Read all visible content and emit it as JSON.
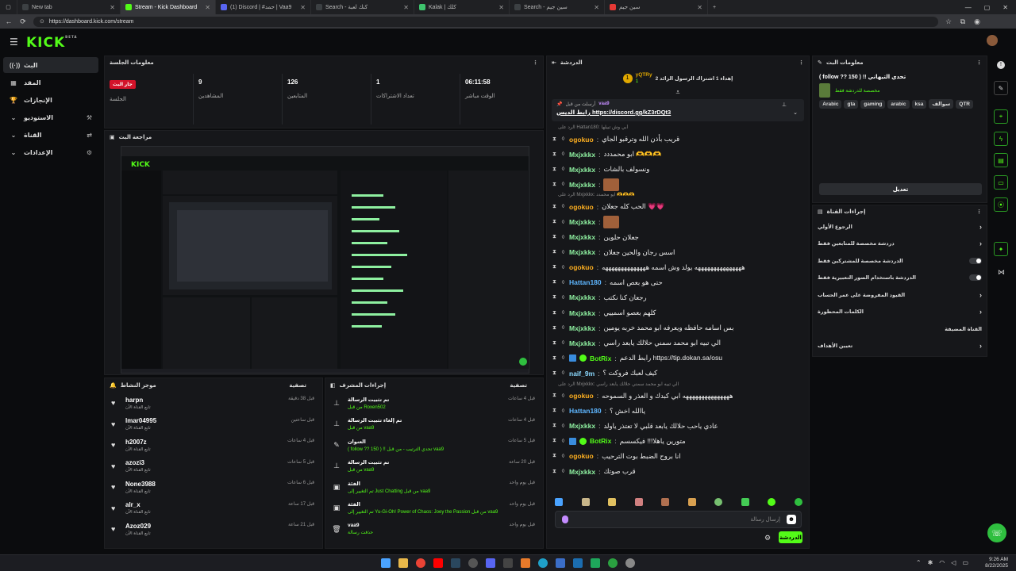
{
  "browser": {
    "tabs": [
      {
        "label": "New tab",
        "color": "#3c4043",
        "active": false
      },
      {
        "label": "Stream - Kick Dashboard",
        "color": "#53fc18",
        "active": true
      },
      {
        "label": "(1) Discord | #حمد | Vaa9",
        "color": "#5865f2",
        "active": false
      },
      {
        "label": "Search - كنك لعبة",
        "color": "#3c4043",
        "active": false
      },
      {
        "label": "Kalak | كلك",
        "color": "#3ec46d",
        "active": false
      },
      {
        "label": "Search - سين جيم",
        "color": "#3c4043",
        "active": false
      },
      {
        "label": "سين جيم",
        "color": "#e53935",
        "active": false
      }
    ],
    "url": "https://dashboard.kick.com/stream"
  },
  "header": {
    "logo": "KICK",
    "logo_sup": "BETA"
  },
  "sidebar": {
    "items": [
      {
        "label": "البث",
        "icon": "broadcast-icon",
        "glyph": "((·))",
        "active": true
      },
      {
        "label": "المقد",
        "icon": "calendar-icon",
        "glyph": "▦",
        "active": false
      },
      {
        "label": "الإنجازات",
        "icon": "trophy-icon",
        "glyph": "🏆",
        "active": false
      },
      {
        "label": "الاستوديو",
        "icon": "studio-icon",
        "glyph": "⌄",
        "right": "⚒",
        "active": false
      },
      {
        "label": "القناة",
        "icon": "channel-icon",
        "glyph": "⌄",
        "right": "⇄",
        "active": false
      },
      {
        "label": "الإعدادات",
        "icon": "settings-icon",
        "glyph": "⌄",
        "right": "⚙",
        "active": false
      }
    ]
  },
  "session": {
    "title": "معلومات الجلسة",
    "live_badge": "جار البث",
    "stats": [
      {
        "value": "",
        "label": "الجلسة"
      },
      {
        "value": "9",
        "label": "المشاهدين"
      },
      {
        "value": "126",
        "label": "المتابعين"
      },
      {
        "value": "1",
        "label": "تعداد الاشتراكات"
      },
      {
        "value": "06:11:58",
        "label": "الوقت مباشر"
      }
    ]
  },
  "preview": {
    "title": "مراجعة البث"
  },
  "activity": {
    "title": "موجز النشاط",
    "filter": "تصفية",
    "items": [
      {
        "name": "harpn",
        "sub": "تابع القناة الآن",
        "time": "قبل 38 دقيقة"
      },
      {
        "name": "lmar04995",
        "sub": "تابع القناة الآن",
        "time": "قبل ساعتين"
      },
      {
        "name": "h2007z",
        "sub": "تابع القناة الآن",
        "time": "قبل 4 ساعات"
      },
      {
        "name": "azozi3",
        "sub": "تابع القناة الآن",
        "time": "قبل 5 ساعات"
      },
      {
        "name": "None3988",
        "sub": "تابع القناة الآن",
        "time": "قبل 6 ساعات"
      },
      {
        "name": "alr_x",
        "sub": "تابع القناة الآن",
        "time": "قبل 17 ساعة"
      },
      {
        "name": "Azoz029",
        "sub": "تابع القناة الآن",
        "time": "قبل 21 ساعة"
      }
    ]
  },
  "mod_actions": {
    "title": "إجراءات المشرف",
    "filter": "تصفية",
    "items": [
      {
        "icon": "pin-icon",
        "glyph": "⊥",
        "t1": "تم تثبيت الرسالة",
        "t2": "من قبل Roxen502",
        "time": "قبل 4 ساعات"
      },
      {
        "icon": "pin-icon",
        "glyph": "⊥",
        "t1": "تم إلغاء تثبيت الرسالة",
        "t2": "من قبل vaa9",
        "time": "قبل 4 ساعات"
      },
      {
        "icon": "title-icon",
        "glyph": "✎",
        "t1": "العنوان",
        "t2": "( follow ?? 150 ) !! تحدي الترتيب - من قبل vaa9",
        "time": "قبل 5 ساعات"
      },
      {
        "icon": "pin-icon",
        "glyph": "⊥",
        "t1": "تم تثبيت الرسالة",
        "t2": "من قبل vaa9",
        "time": "قبل 20 ساعة"
      },
      {
        "icon": "category-icon",
        "glyph": "▣",
        "t1": "الفئة",
        "t2": "تم التغيير إلى Just Chatting من قبل vaa9",
        "time": "قبل يوم واحد"
      },
      {
        "icon": "category-icon",
        "glyph": "▣",
        "t1": "الفئة",
        "t2": "تم التغيير إلى Yu-Gi-Oh! Power of Chaos: Joey the Passion من قبل vaa9",
        "time": "قبل يوم واحد"
      },
      {
        "icon": "trash-icon",
        "glyph": "🗑",
        "t1": "vaa9",
        "t2": "حذفت رسالة",
        "time": "قبل يوم واحد"
      }
    ]
  },
  "chat": {
    "title": "الدردشة",
    "sub_goal_user": "yQTRy",
    "sub_goal_text": "إهداء 1 اشتراك الرسول الزائد 2",
    "sub_goal_count": "1",
    "pinned_by": "vaa9",
    "pinned_label": "أرسلت من قبل",
    "pinned_text": "رابط الديس https://discord.gg/kZ3rDQt3",
    "messages": [
      {
        "reply": "الرد على Hattan180: أبي وش تبيلها",
        "user": "",
        "color": "#8bd9ff",
        "text": ""
      },
      {
        "reply": "",
        "user": "ogokuo",
        "color": "#ffb020",
        "text": "قريب بأذن الله وترقبو الجاي"
      },
      {
        "reply": "",
        "user": "Mxjxkkx",
        "color": "#8ef0a0",
        "text": "ابو محمددد 🫶🫶🫶"
      },
      {
        "reply": "",
        "user": "Mxjxkkx",
        "color": "#8ef0a0",
        "text": "ونسولف بالشات"
      },
      {
        "reply": "",
        "user": "Mxjxkkx",
        "color": "#8ef0a0",
        "text": "[emote]"
      },
      {
        "reply": "الرد على Mxjxkkx: ايو محمدد 🫶🫶🫶",
        "user": "ogokuo",
        "color": "#ffb020",
        "text": "الحب كله جعلان 💗💗"
      },
      {
        "reply": "",
        "user": "Mxjxkkx",
        "color": "#8ef0a0",
        "text": "[emote]"
      },
      {
        "reply": "",
        "user": "Mxjxkkx",
        "color": "#8ef0a0",
        "text": "جعلان حلوين"
      },
      {
        "reply": "",
        "user": "Mxjxkkx",
        "color": "#8ef0a0",
        "text": "اسس رجان والحين جعلان"
      },
      {
        "reply": "",
        "user": "ogokuo",
        "color": "#ffb020",
        "text": "هههههههههههههههه يولد وش اسمه ههههههههههههههه"
      },
      {
        "reply": "",
        "user": "Hattan180",
        "color": "#5eb6ff",
        "text": "حتى هو بعص اسمه"
      },
      {
        "reply": "",
        "user": "Mxjxkkx",
        "color": "#8ef0a0",
        "text": "رجعان كنا نكتب"
      },
      {
        "reply": "",
        "user": "Mxjxkkx",
        "color": "#8ef0a0",
        "text": "كلهم بعصو اسمييي"
      },
      {
        "reply": "",
        "user": "Mxjxkkx",
        "color": "#8ef0a0",
        "text": "بس اسامه حافظه ويعرفه ابو محمد خربه يومين"
      },
      {
        "reply": "",
        "user": "Mxjxkkx",
        "color": "#8ef0a0",
        "text": "الي تبيه ابو محمد سمني حلالك يابعد راسي"
      },
      {
        "reply": "",
        "user": "BotRix",
        "color": "#53fc18",
        "text": "رابط الدعم https://tip.dokan.sa/osu"
      },
      {
        "reply": "",
        "user": "naif_9m",
        "color": "#8bd9ff",
        "text": "كيف لعبك فروكت ؟"
      },
      {
        "reply": "الرد على Mxjxkkx: الي تبيه ابو محمد سمني حلالك يابعد راسي",
        "user": "ogokuo",
        "color": "#ffb020",
        "text": "هههههههههههههههه ابي كبدك و العذر و السموحه"
      },
      {
        "reply": "",
        "user": "Hattan180",
        "color": "#5eb6ff",
        "text": "ياالله اخش ؟"
      },
      {
        "reply": "",
        "user": "Mxjxkkx",
        "color": "#8ef0a0",
        "text": "عادي ياحب حلالك يابعد قلبي لا تعتذر ياولد"
      },
      {
        "reply": "",
        "user": "BotRix",
        "color": "#53fc18",
        "text": "متورين ياهلا!!! فيكسسم"
      },
      {
        "reply": "",
        "user": "ogokuo",
        "color": "#ffb020",
        "text": "انا بروح الضبط بوت الترحيب"
      },
      {
        "reply": "",
        "user": "Mxjxkkx",
        "color": "#8ef0a0",
        "text": "قرب صوتك"
      }
    ],
    "input_placeholder": "إرسال رسالة",
    "send_label": "الدردشة"
  },
  "stream_info": {
    "title": "معلومات البث",
    "stream_title": "( follow ?? 150 ) !! تحدي التيهاني",
    "category_label": "مخصصة للدردشة فقط",
    "tags": [
      "QTR",
      "سوالف",
      "ksa",
      "arabic",
      "gaming",
      "gta",
      "Arabic"
    ],
    "edit_label": "تعديل"
  },
  "channel_actions": {
    "title": "إجراءات القناة",
    "rows": [
      {
        "label": "الرجوع الأولي",
        "type": "chevron"
      },
      {
        "label": "دردشة مخصصة للمتابعين فقط",
        "type": "chevron"
      },
      {
        "label": "الدردشة مخصصة للمشتركين فقط",
        "type": "toggle"
      },
      {
        "label": "الدردشة باستخدام الصور التعبيرية فقط",
        "type": "toggle"
      },
      {
        "label": "القيود المفروضة على عمر الحساب",
        "type": "chevron"
      },
      {
        "label": "الكلمات المحظورة",
        "type": "chevron"
      },
      {
        "label": "القناة المضيفة",
        "type": "none"
      },
      {
        "label": "تعيين الأهداف",
        "type": "chevron"
      }
    ]
  },
  "taskbar": {
    "time": "9:26 AM",
    "date": "8/22/2025"
  },
  "colors": {
    "accent": "#53fc18",
    "live": "#d3132a",
    "bg": "#0b0c0e",
    "panel": "#16171a"
  }
}
